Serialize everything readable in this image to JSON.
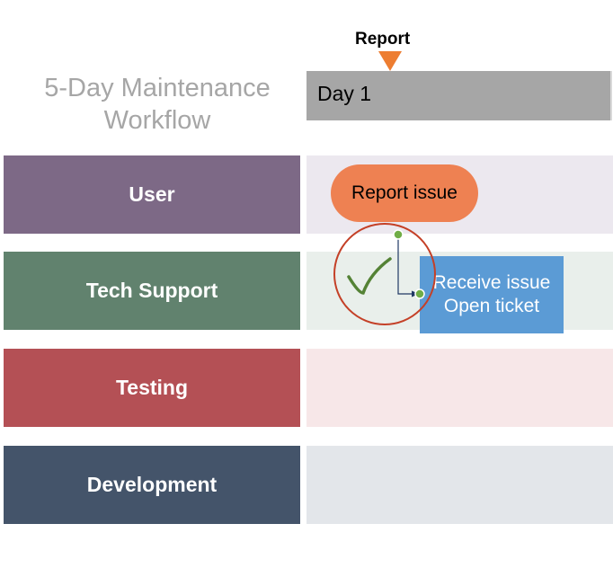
{
  "title": "5-Day Maintenance Workflow",
  "phase_label": "Report",
  "day_header": "Day 1",
  "lanes": {
    "user": "User",
    "tech_support": "Tech Support",
    "testing": "Testing",
    "development": "Development"
  },
  "nodes": {
    "report_issue": "Report issue",
    "receive_issue_line1": "Receive issue",
    "receive_issue_line2": "Open ticket"
  },
  "colors": {
    "lane_user": "#7d6986",
    "lane_tech": "#61826e",
    "lane_testing": "#b45055",
    "lane_dev": "#44546a",
    "accent_orange": "#ed7d31",
    "node_blue": "#5b9bd5",
    "selection_outline": "#c44027",
    "connector_green": "#548235",
    "handle_green": "#70ad47"
  }
}
